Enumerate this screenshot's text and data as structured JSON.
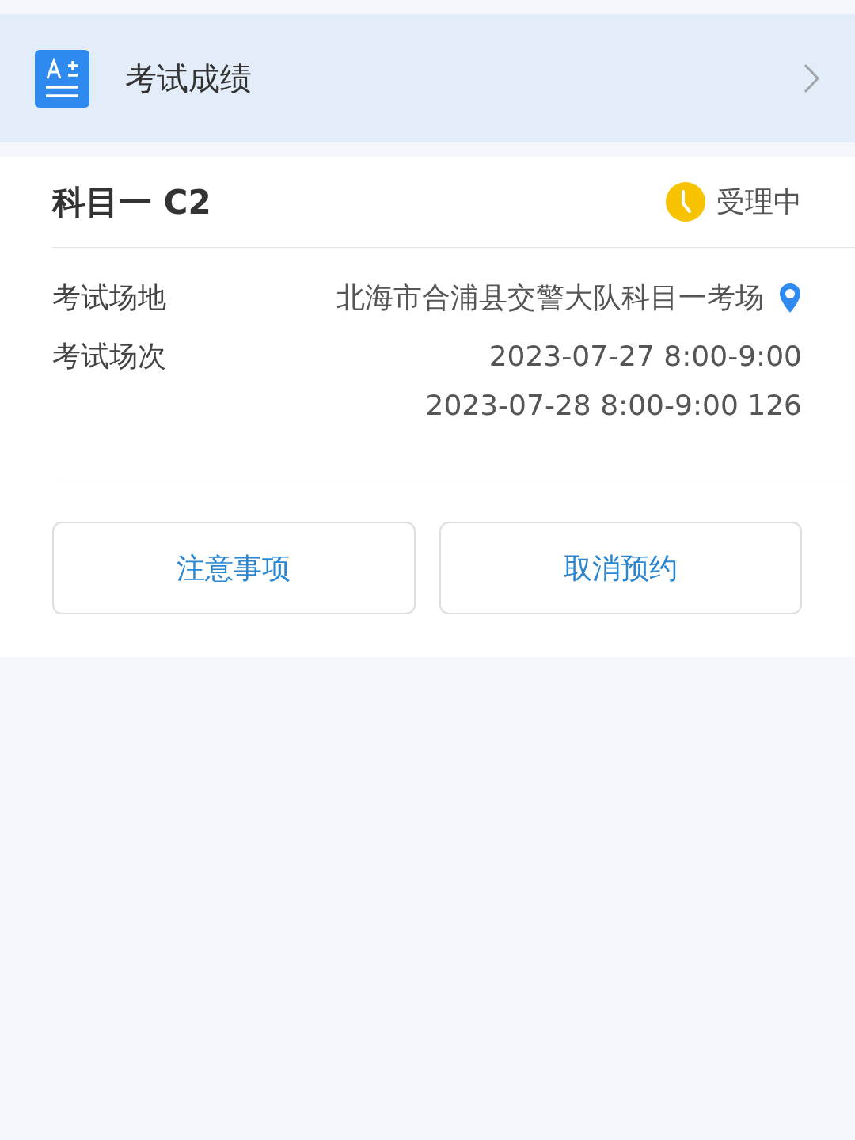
{
  "header": {
    "title": "考试成绩"
  },
  "card": {
    "subject": "科目一 C2",
    "status": {
      "label": "受理中",
      "kind": "pending"
    },
    "rows": [
      {
        "label": "考试场地",
        "lines": [
          "北海市合浦县交警大队科目一考场"
        ],
        "has_location": true
      },
      {
        "label": "考试场次",
        "lines": [
          "2023-07-27 8:00-9:00",
          "2023-07-28 8:00-9:00 126"
        ],
        "has_location": false
      }
    ],
    "buttons": [
      "注意事项",
      "取消预约"
    ]
  }
}
